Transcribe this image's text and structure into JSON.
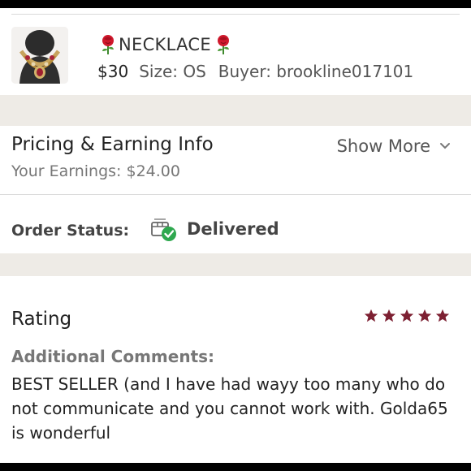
{
  "item": {
    "title": "NECKLACE",
    "price": "$30",
    "size": "Size: OS",
    "buyer": "Buyer: brookline017101",
    "title_emoji": "rose-icon"
  },
  "pricing": {
    "title": "Pricing & Earning Info",
    "earnings": "Your Earnings: $24.00",
    "show_more": "Show More"
  },
  "order_status": {
    "label": "Order Status:",
    "value": "Delivered",
    "status_color": "#2fa84f"
  },
  "rating": {
    "title": "Rating",
    "stars": 5,
    "star_color": "#7d2032",
    "comments_label": "Additional Comments:",
    "comment": "BEST SELLER (and I have had wayy too many who do not communicate and you cannot work with. Golda65 is wonderful"
  },
  "colors": {
    "band": "#eeebe6",
    "divider": "#dcdcdc"
  }
}
